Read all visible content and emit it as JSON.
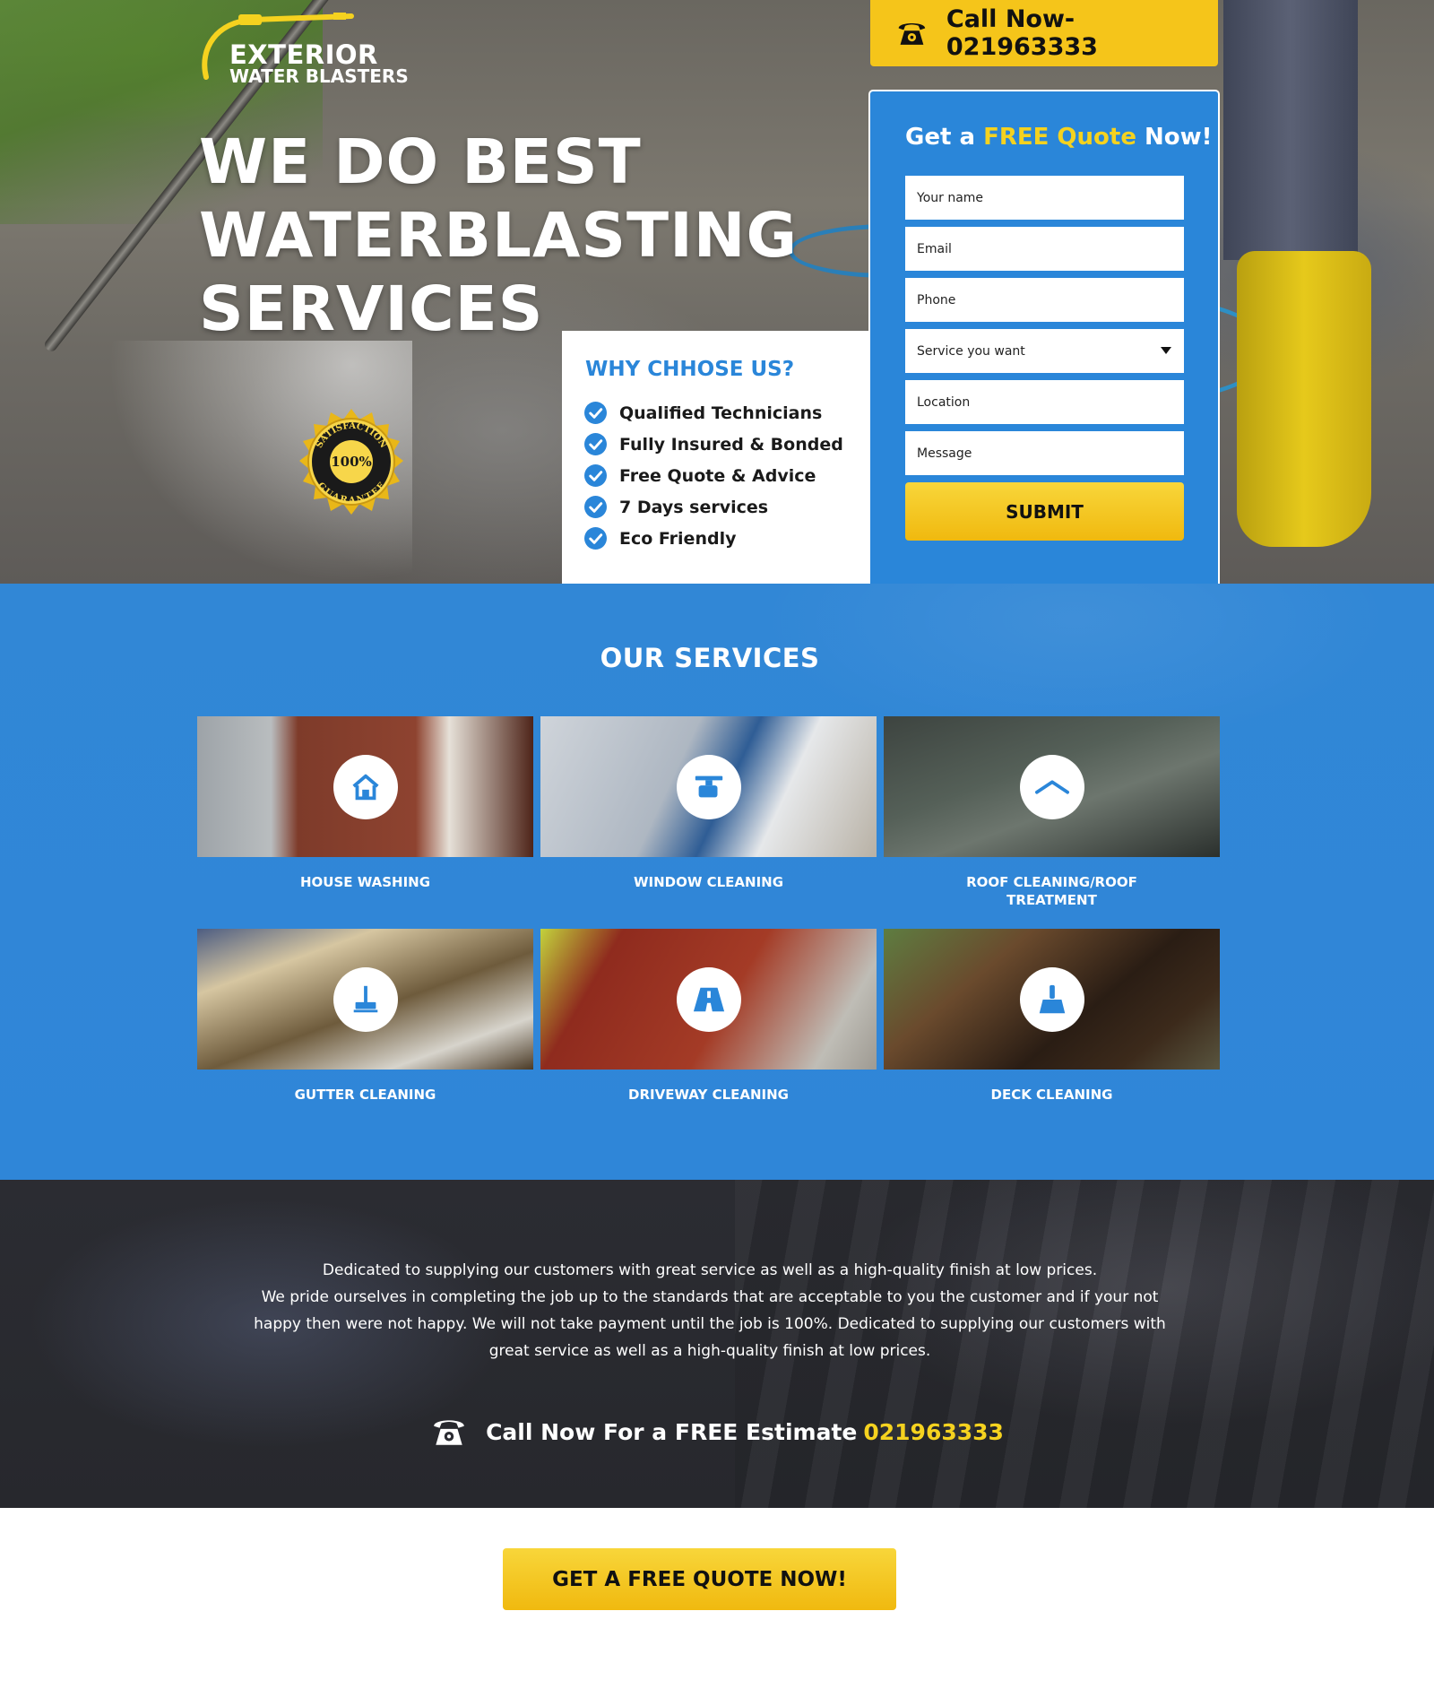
{
  "brand": {
    "name": "EXTERIOR",
    "sub": "WATER BLASTERS",
    "accent": "#2a86d9",
    "yellow": "#f5c51a"
  },
  "header": {
    "call_label": "Call Now-021963333",
    "phone_icon": "phone-icon"
  },
  "hero": {
    "headline_lines": [
      "WE DO BEST",
      "WATERBLASTING",
      "SERVICES"
    ],
    "badge": {
      "top": "SATISFACTION",
      "center": "100%",
      "bottom": "GUARANTEE"
    }
  },
  "why": {
    "title": "WHY CHHOSE US?",
    "items": [
      "Qualified Technicians",
      "Fully Insured & Bonded",
      "Free Quote & Advice",
      "7 Days services",
      "Eco Friendly"
    ]
  },
  "form": {
    "title_pre": "Get a ",
    "title_hl": "FREE Quote",
    "title_post": " Now!",
    "name_placeholder": "Your name",
    "email_placeholder": "Email",
    "phone_placeholder": "Phone",
    "service_value": "Service you want",
    "location_placeholder": "Location",
    "message_placeholder": "Message",
    "submit_label": "SUBMIT"
  },
  "services": {
    "title": "OUR SERVICES",
    "items": [
      {
        "label": "HOUSE WASHING",
        "icon": "house-icon"
      },
      {
        "label": "WINDOW CLEANING",
        "icon": "squeegee-icon"
      },
      {
        "label": "ROOF CLEANING/ROOF TREATMENT",
        "icon": "roof-icon"
      },
      {
        "label": "GUTTER CLEANING",
        "icon": "gutter-icon"
      },
      {
        "label": "DRIVEWAY CLEANING",
        "icon": "driveway-icon"
      },
      {
        "label": "DECK CLEANING",
        "icon": "broom-icon"
      }
    ]
  },
  "about": {
    "line1": "Dedicated to supplying our customers with great service as well as a high-quality finish at low prices.",
    "line2": "We pride ourselves in completing the job up to the standards that are acceptable to you the customer and if your not happy then were not happy. We will not take payment until the job is 100%. Dedicated to supplying our customers with great service as well as a high-quality finish at low prices.",
    "cta_text": "Call Now For a FREE Estimate",
    "cta_number": "021963333"
  },
  "bottom_cta": {
    "label": "GET A FREE QUOTE NOW!"
  }
}
